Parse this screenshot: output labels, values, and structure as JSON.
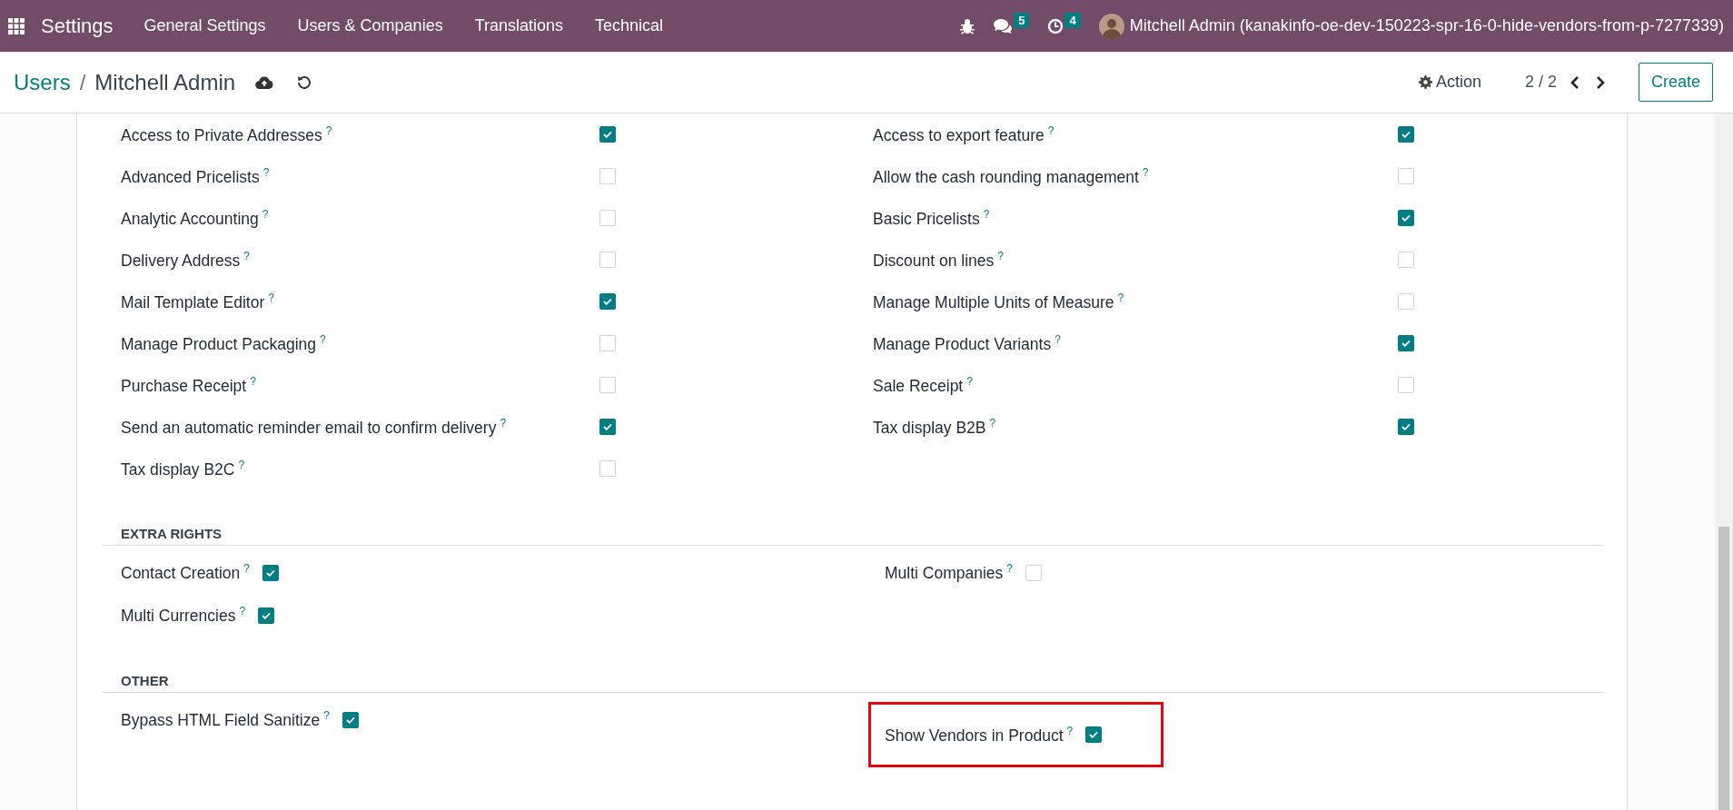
{
  "navbar": {
    "app_name": "Settings",
    "menus": [
      "General Settings",
      "Users & Companies",
      "Translations",
      "Technical"
    ],
    "messages_count": "5",
    "activities_count": "4",
    "user": "Mitchell Admin (kanakinfo-oe-dev-150223-spr-16-0-hide-vendors-from-p-7277339)"
  },
  "control_panel": {
    "breadcrumb_parent": "Users",
    "separator": "/",
    "breadcrumb_current": "Mitchell Admin",
    "action": "Action",
    "pager": "2 / 2",
    "create": "Create"
  },
  "sections": [
    {
      "kind": "wide",
      "columns": [
        [
          {
            "label": "Access to Private Addresses",
            "help": "?",
            "checked": true,
            "highlighted": false
          },
          {
            "label": "Advanced Pricelists",
            "help": "?",
            "checked": false,
            "highlighted": false
          },
          {
            "label": "Analytic Accounting",
            "help": "?",
            "checked": false,
            "highlighted": false
          },
          {
            "label": "Delivery Address",
            "help": "?",
            "checked": false,
            "highlighted": false
          },
          {
            "label": "Mail Template Editor",
            "help": "?",
            "checked": true,
            "highlighted": false
          },
          {
            "label": "Manage Product Packaging",
            "help": "?",
            "checked": false,
            "highlighted": false
          },
          {
            "label": "Purchase Receipt",
            "help": "?",
            "checked": false,
            "highlighted": false
          },
          {
            "label": "Send an automatic reminder email to confirm delivery",
            "help": "?",
            "checked": true,
            "highlighted": false
          },
          {
            "label": "Tax display B2C",
            "help": "?",
            "checked": false,
            "highlighted": false
          }
        ],
        [
          {
            "label": "Access to export feature",
            "help": "?",
            "checked": true,
            "highlighted": false
          },
          {
            "label": "Allow the cash rounding management",
            "help": "?",
            "checked": false,
            "highlighted": false
          },
          {
            "label": "Basic Pricelists",
            "help": "?",
            "checked": true,
            "highlighted": false
          },
          {
            "label": "Discount on lines",
            "help": "?",
            "checked": false,
            "highlighted": false
          },
          {
            "label": "Manage Multiple Units of Measure",
            "help": "?",
            "checked": false,
            "highlighted": false
          },
          {
            "label": "Manage Product Variants",
            "help": "?",
            "checked": true,
            "highlighted": false
          },
          {
            "label": "Sale Receipt",
            "help": "?",
            "checked": false,
            "highlighted": false
          },
          {
            "label": "Tax display B2B",
            "help": "?",
            "checked": true,
            "highlighted": false
          }
        ]
      ]
    },
    {
      "kind": "inline",
      "title": "EXTRA RIGHTS",
      "columns": [
        [
          {
            "label": "Contact Creation",
            "help": "?",
            "checked": true,
            "highlighted": false
          },
          {
            "label": "Multi Currencies",
            "help": "?",
            "checked": true,
            "highlighted": false
          }
        ],
        [
          {
            "label": "Multi Companies",
            "help": "?",
            "checked": false,
            "highlighted": false
          }
        ]
      ]
    },
    {
      "kind": "inline",
      "title": "OTHER",
      "columns": [
        [
          {
            "label": "Bypass HTML Field Sanitize",
            "help": "?",
            "checked": true,
            "highlighted": false
          }
        ],
        [
          {
            "label": "Show Vendors in Product",
            "help": "?",
            "checked": true,
            "highlighted": true
          }
        ]
      ]
    }
  ]
}
